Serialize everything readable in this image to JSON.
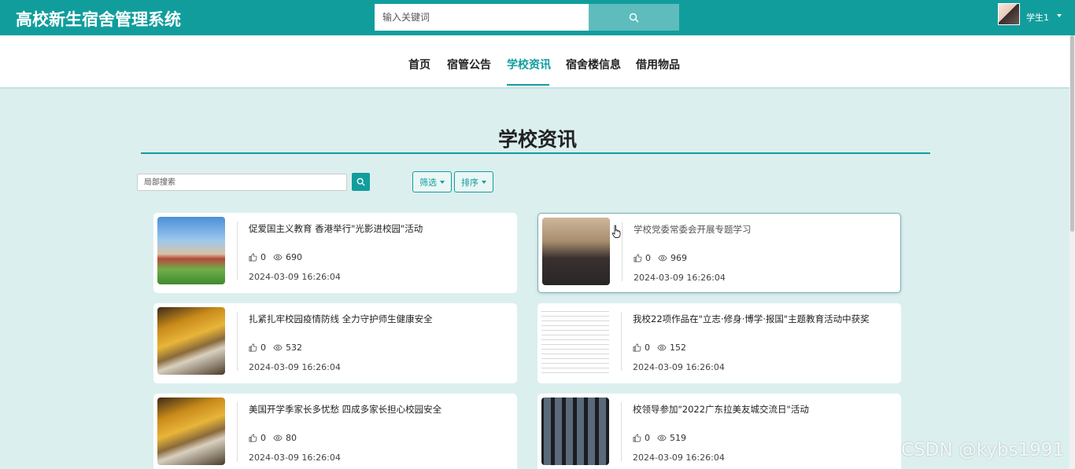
{
  "header": {
    "app_title": "高校新生宿舍管理系统",
    "search_placeholder": "输入关键词",
    "username": "学生1"
  },
  "nav": {
    "items": [
      {
        "label": "首页"
      },
      {
        "label": "宿管公告"
      },
      {
        "label": "学校资讯"
      },
      {
        "label": "宿舍楼信息"
      },
      {
        "label": "借用物品"
      }
    ],
    "active_label": "学校资讯"
  },
  "page": {
    "heading": "学校资讯",
    "local_search_placeholder": "局部搜索",
    "filter_label": "筛选",
    "sort_label": "排序"
  },
  "news": [
    {
      "title": "促爱国主义教育 香港举行\"光影进校园\"活动",
      "likes": "0",
      "views": "690",
      "date": "2024-03-09 16:26:04",
      "thumb": "campus-photo"
    },
    {
      "title": "学校党委常委会开展专题学习",
      "likes": "0",
      "views": "969",
      "date": "2024-03-09 16:26:04",
      "thumb": "meeting-photo"
    },
    {
      "title": "扎紧扎牢校园疫情防线 全力守护师生健康安全",
      "likes": "0",
      "views": "532",
      "date": "2024-03-09 16:26:04",
      "thumb": "autumn-gate-photo"
    },
    {
      "title": "我校22项作品在\"立志·修身·博学·报国\"主题教育活动中获奖",
      "likes": "0",
      "views": "152",
      "date": "2024-03-09 16:26:04",
      "thumb": "document-photo"
    },
    {
      "title": "美国开学季家长多忧愁 四成多家长担心校园安全",
      "likes": "0",
      "views": "80",
      "date": "2024-03-09 16:26:04",
      "thumb": "autumn-gate-photo"
    },
    {
      "title": "校领导参加\"2022广东拉美友城交流日\"活动",
      "likes": "0",
      "views": "519",
      "date": "2024-03-09 16:26:04",
      "thumb": "video-call-photo"
    }
  ],
  "watermark": "CSDN @kybs1991",
  "colors": {
    "primary": "#129d9d",
    "background": "#dcefef"
  }
}
